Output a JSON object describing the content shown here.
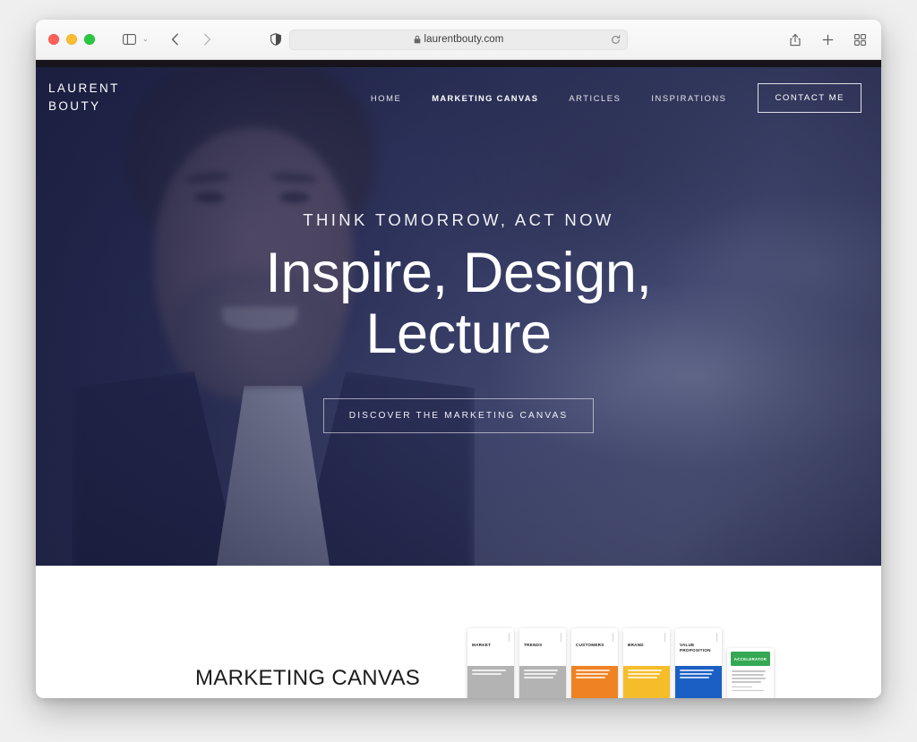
{
  "browser": {
    "traffic_lights": [
      "close",
      "minimize",
      "zoom"
    ],
    "sidebar_icon": "sidebar-icon",
    "sidebar_chevron": "⌄",
    "back_icon": "chevron-left-icon",
    "forward_icon": "chevron-right-icon",
    "shield_icon": "privacy-shield-icon",
    "url": "laurentbouty.com",
    "lock_icon": "lock-icon",
    "reload_icon": "reload-icon",
    "share_icon": "share-icon",
    "new_tab_icon": "plus-icon",
    "tab_overview_icon": "tab-overview-icon"
  },
  "site": {
    "logo": {
      "line1": "LAURENT",
      "line2": "BOUTY"
    },
    "nav": [
      {
        "label": "HOME",
        "active": false
      },
      {
        "label": "MARKETING CANVAS",
        "active": true
      },
      {
        "label": "ARTICLES",
        "active": false
      },
      {
        "label": "INSPIRATIONS",
        "active": false
      }
    ],
    "cta_button": "CONTACT ME"
  },
  "hero": {
    "eyebrow": "THINK TOMORROW, ACT NOW",
    "headline": "Inspire, Design, Lecture",
    "button": "DISCOVER THE MARKETING CANVAS",
    "overlay_color": "#242a50",
    "photo_alt": "smiling man in dark suit and white shirt"
  },
  "section": {
    "title": "MARKETING CANVAS",
    "cards": [
      {
        "title": "MARKET",
        "color": "#b3b3b3",
        "kind": "block"
      },
      {
        "title": "TRENDS",
        "color": "#b3b3b3",
        "kind": "block"
      },
      {
        "title": "CUSTOMERS",
        "color": "#ef8323",
        "kind": "block"
      },
      {
        "title": "BRAND",
        "color": "#f6bd2b",
        "kind": "block"
      },
      {
        "title": "VALUE PROPOSITION",
        "color": "#1b5fc4",
        "kind": "block"
      },
      {
        "title": "ACCELERATOR",
        "color": "#34a853",
        "kind": "header"
      }
    ]
  }
}
